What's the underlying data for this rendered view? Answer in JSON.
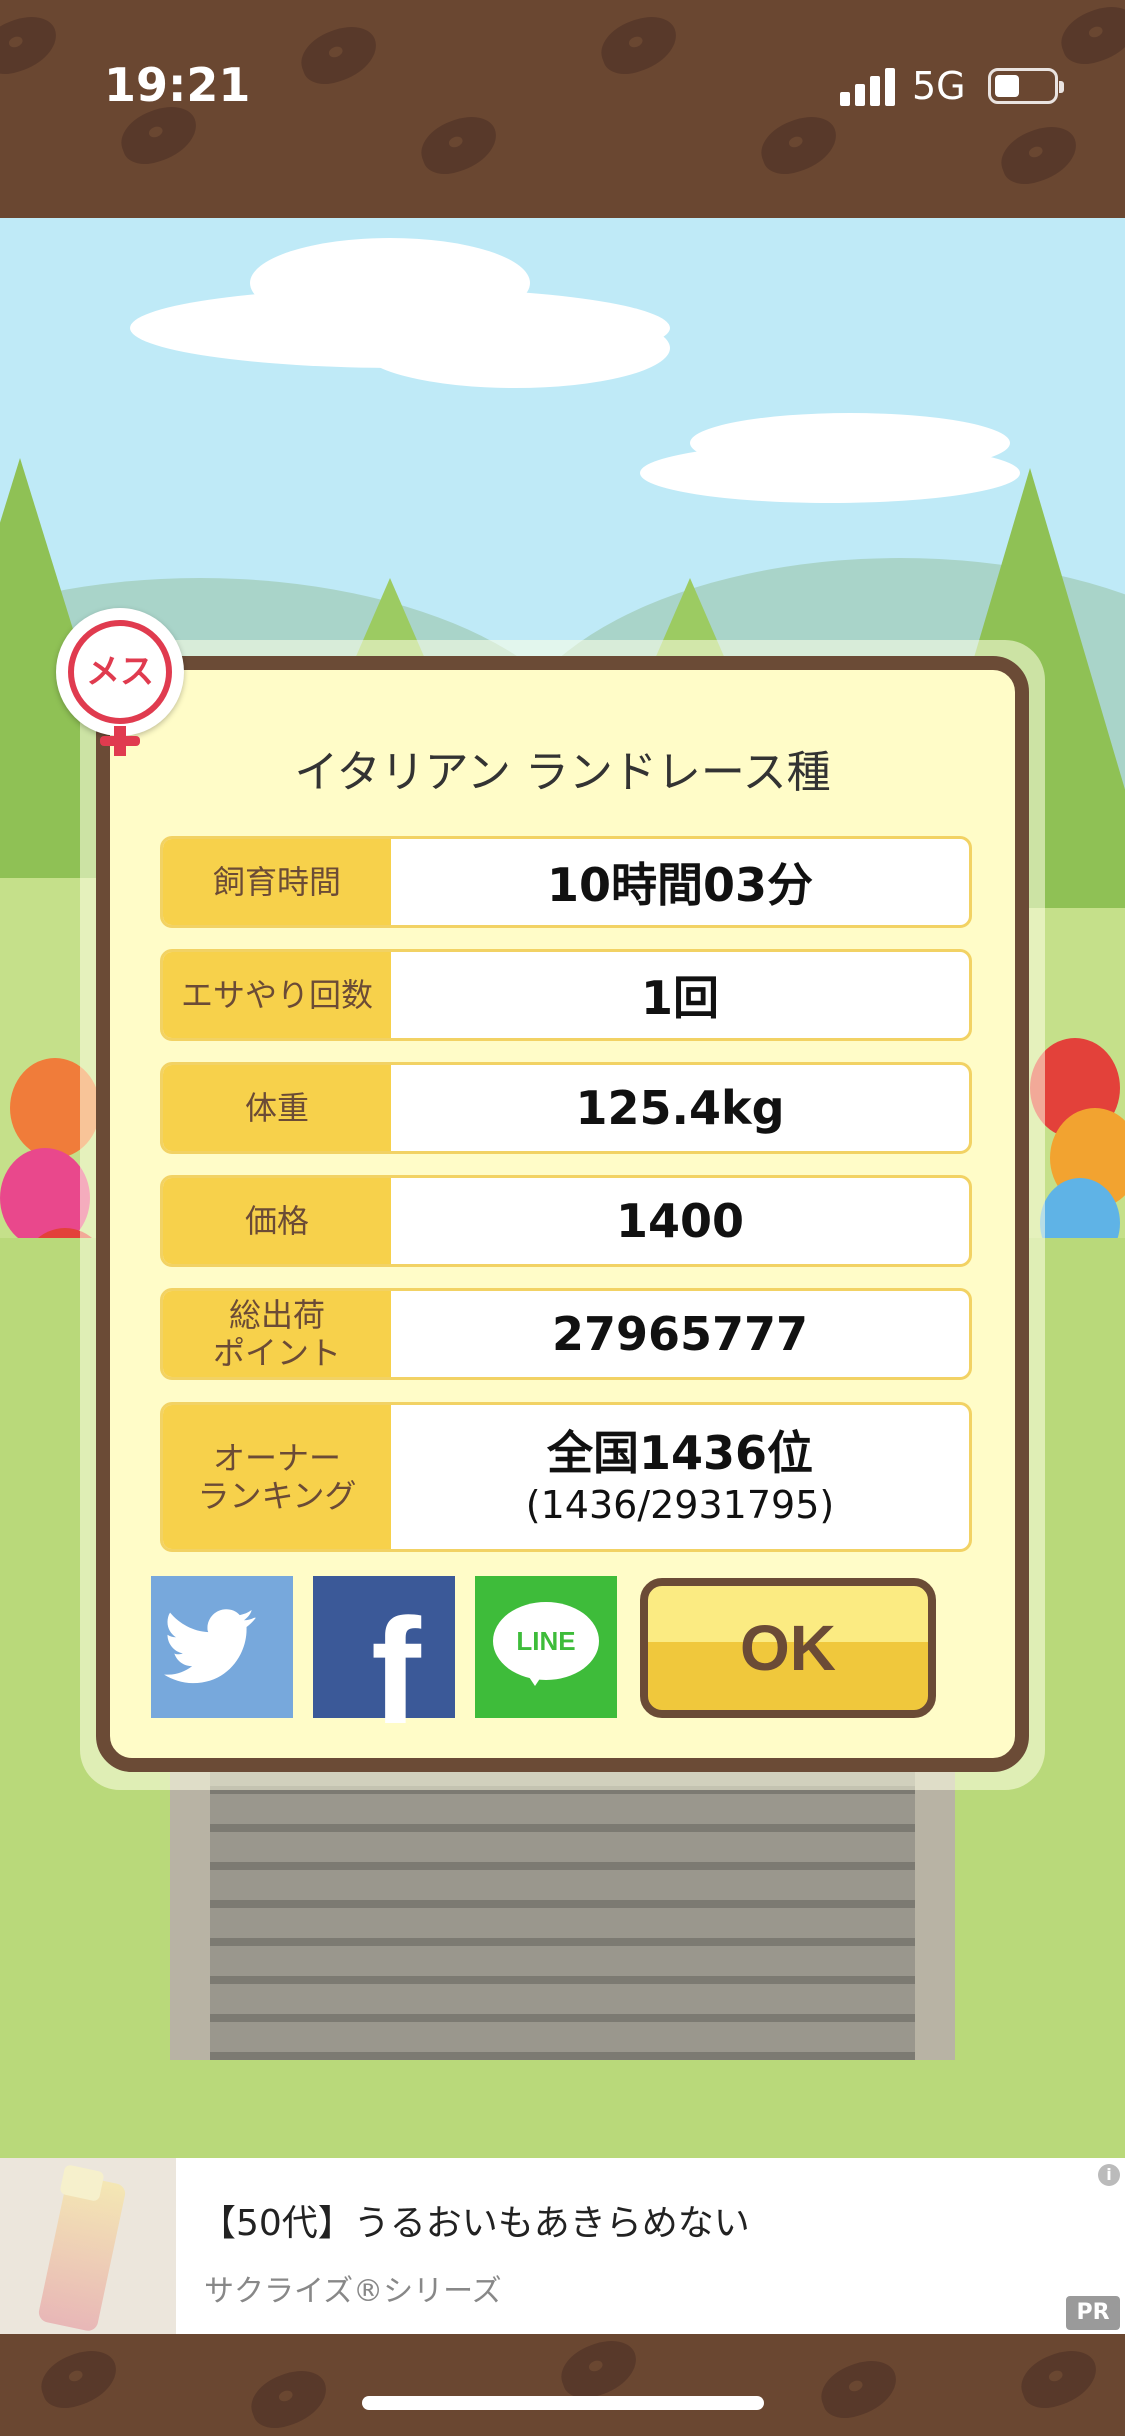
{
  "status_bar": {
    "time": "19:21",
    "network": "5G",
    "signal_bars": 4,
    "battery_level": 0.35
  },
  "dialog": {
    "gender_badge": "メス",
    "title": "イタリアン ランドレース種",
    "rows": [
      {
        "label": "飼育時間",
        "value": "10時間03分"
      },
      {
        "label": "エサやり回数",
        "value": "1回"
      },
      {
        "label": "体重",
        "value": "125.4kg"
      },
      {
        "label": "価格",
        "value": "1400"
      },
      {
        "label": "総出荷\nポイント",
        "value": "27965777"
      },
      {
        "label": "オーナー\nランキング",
        "value": "全国1436位",
        "sub_value": "(1436/2931795)"
      }
    ],
    "share": {
      "twitter_icon": "twitter-bird-icon",
      "facebook_icon": "facebook-f-icon",
      "line_label": "LINE"
    },
    "ok_label": "OK"
  },
  "ad": {
    "title": "【50代】うるおいもあきらめない",
    "subtitle": "サクライズ®シリーズ",
    "pr_label": "PR",
    "info_label": "i"
  },
  "colors": {
    "brown": "#6b4b36",
    "label_yellow": "#f7d14b",
    "dialog_bg": "#fffcc8",
    "twitter": "#77a8dc",
    "facebook": "#3b5998",
    "line": "#3ebc3a"
  }
}
